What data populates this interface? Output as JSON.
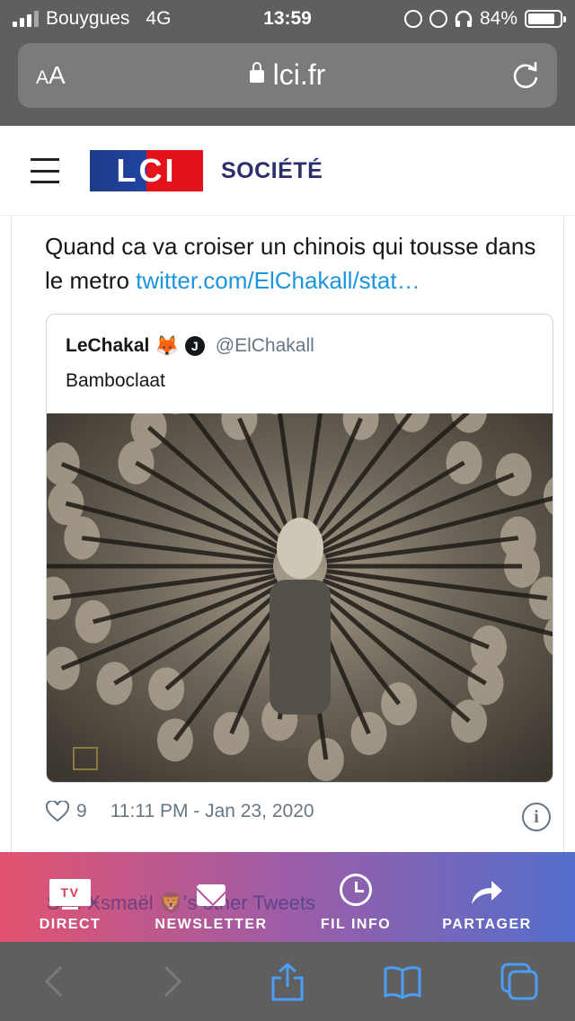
{
  "status": {
    "carrier": "Bouygues",
    "network": "4G",
    "time": "13:59",
    "battery": "84%",
    "battery_level": 0.84
  },
  "browser": {
    "text_size_small": "A",
    "text_size_large": "A",
    "domain": "lci.fr"
  },
  "site": {
    "logo": "LCI",
    "section": "SOCIÉTÉ"
  },
  "tweet": {
    "text": "Quand ca va croiser un chinois qui tousse dans le metro ",
    "link": "twitter.com/ElChakall/stat…",
    "likes": "9",
    "timestamp": "11:11 PM - Jan 23, 2020",
    "quoted": {
      "name": "LeChakal",
      "emoji": "🦊",
      "badge": "J",
      "handle": "@ElChakall",
      "text": "Bamboclaat"
    },
    "more_tweets": "See Ӿsmaël 🦁's other Tweets"
  },
  "nav": {
    "tv_badge": "TV",
    "direct": "DIRECT",
    "newsletter": "NEWSLETTER",
    "fil_info": "FIL INFO",
    "partager": "PARTAGER"
  },
  "icons": [
    "signal-icon",
    "lock-icon",
    "alarm-icon",
    "headphones-icon",
    "reload-icon",
    "menu-icon",
    "heart-icon",
    "info-icon",
    "tv-icon",
    "mail-icon",
    "clock-icon",
    "share-arrow-icon",
    "back-icon",
    "forward-icon",
    "share-icon",
    "bookmarks-icon",
    "tabs-icon"
  ],
  "colors": {
    "link": "#1b95e0",
    "section": "#2a2e6b",
    "lci_blue": "#1e3b8a",
    "lci_red": "#e3121b"
  }
}
